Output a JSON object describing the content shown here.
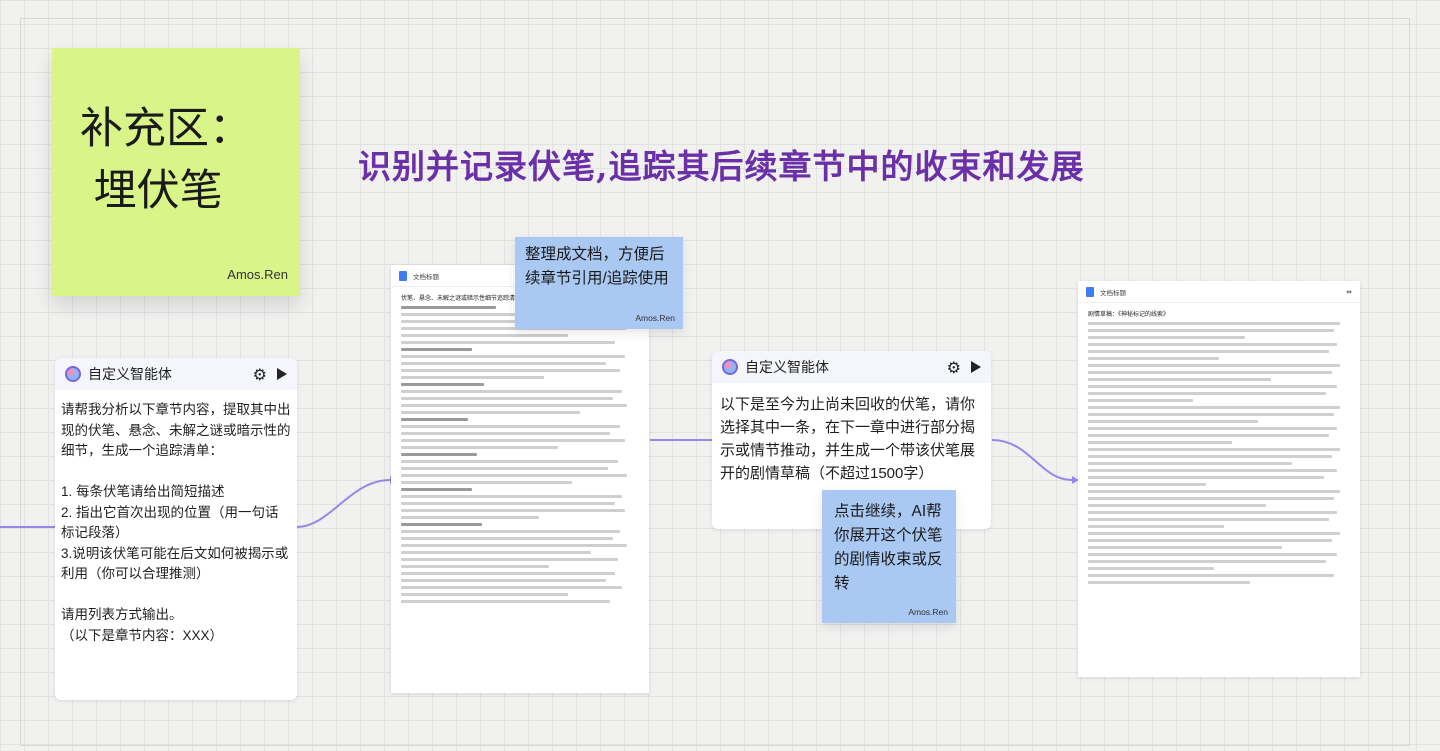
{
  "sticky_main": {
    "title": "补充区：\n 埋伏笔",
    "author": "Amos.Ren"
  },
  "headline": "识别并记录伏笔,追踪其后续章节中的收束和发展",
  "agent1": {
    "title": "自定义智能体",
    "prompt": "请帮我分析以下章节内容，提取其中出现的伏笔、悬念、未解之谜或暗示性的细节，生成一个追踪清单：\n\n1. 每条伏笔请给出简短描述\n2. 指出它首次出现的位置（用一句话标记段落）\n3.说明该伏笔可能在后文如何被揭示或利用（你可以合理推测）\n\n请用列表方式输出。\n（以下是章节内容：XXX）",
    "gear_icon": "gear-icon",
    "play_icon": "play-icon"
  },
  "doc1": {
    "tab": "文档标题",
    "heading": "伏笔、悬念、未解之谜或暗示性细节追踪清单"
  },
  "note1": {
    "text": "整理成文档，方便后续章节引用/追踪使用",
    "author": "Amos.Ren"
  },
  "agent2": {
    "title": "自定义智能体",
    "prompt": "以下是至今为止尚未回收的伏笔，请你选择其中一条，在下一章中进行部分揭示或情节推动，并生成一个带该伏笔展开的剧情草稿（不超过1500字）"
  },
  "note2": {
    "text": "点击继续，AI帮你展开这个伏笔的剧情收束或反转",
    "author": "Amos.Ren"
  },
  "doc2": {
    "tab": "文档标题",
    "heading": "剧情草稿：《神秘标记的线索》"
  },
  "colors": {
    "sticky_green": "#d9f58a",
    "sticky_blue": "#a9c8f2",
    "headline": "#6b30a8",
    "connector": "#9a86e8"
  }
}
